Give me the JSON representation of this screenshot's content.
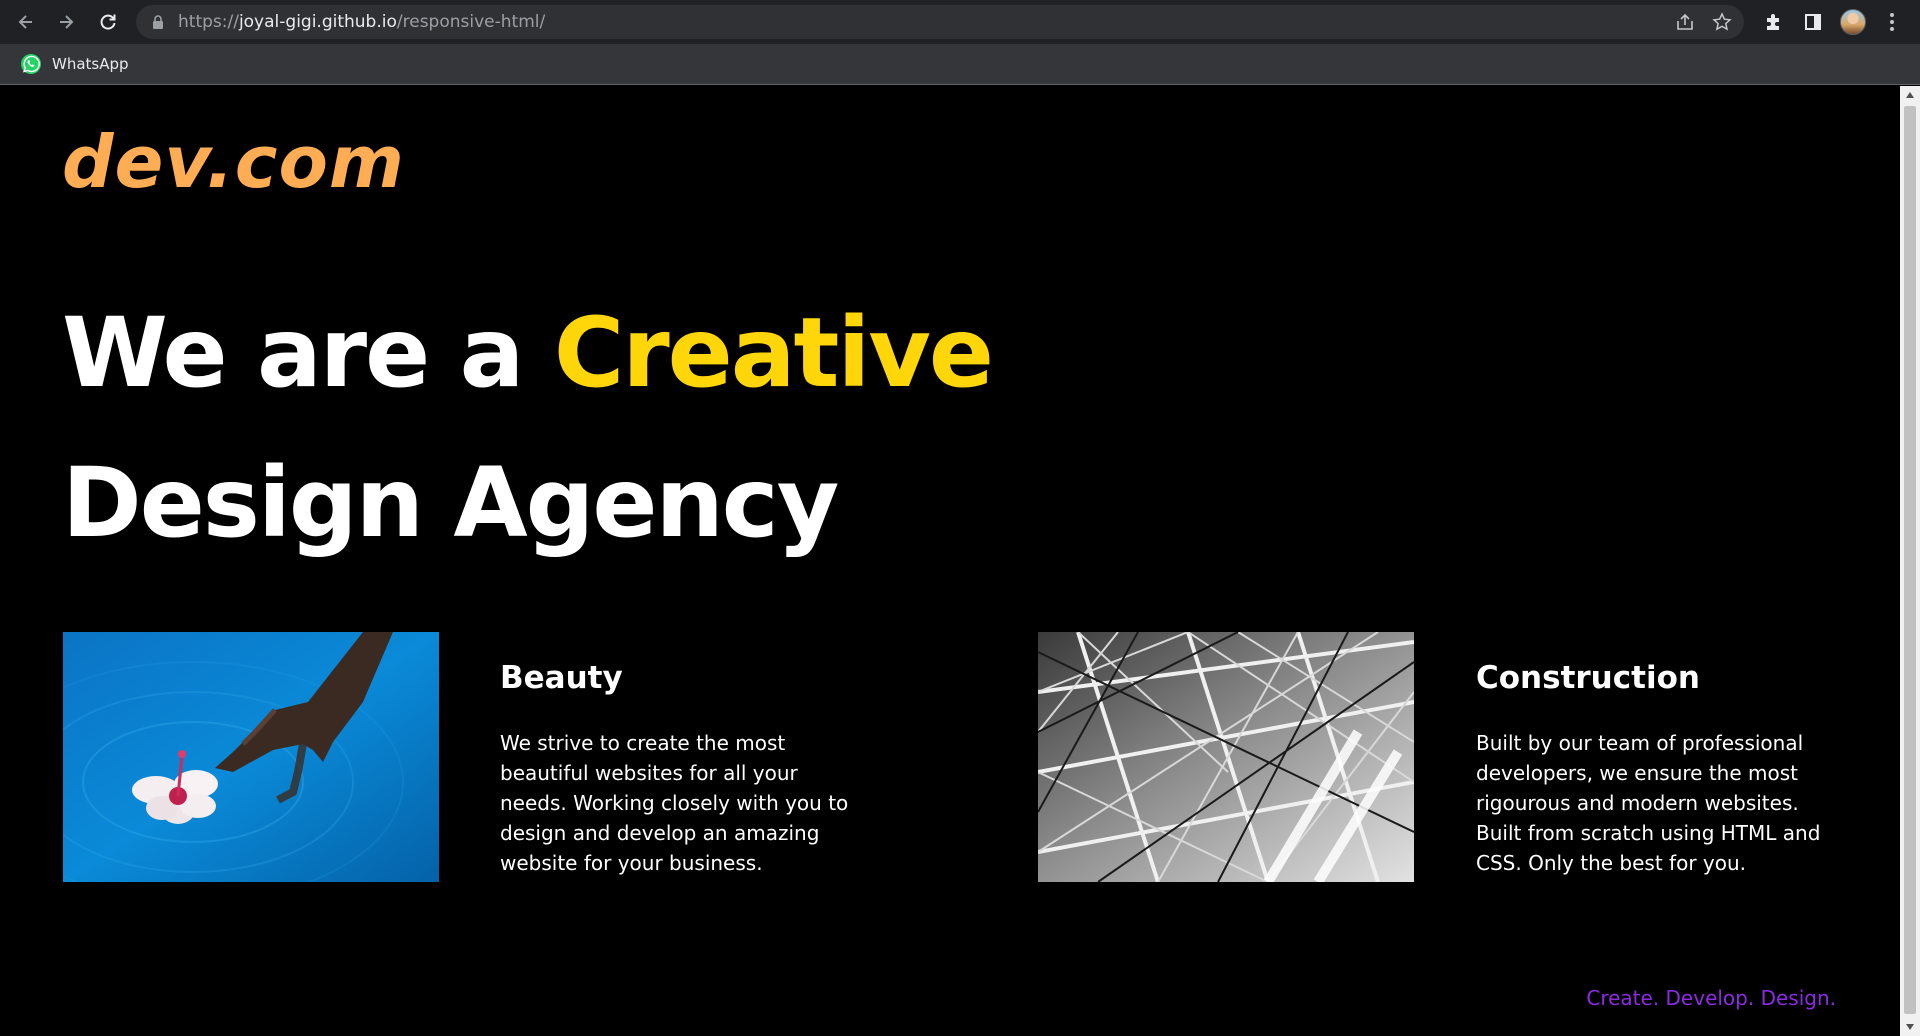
{
  "browser": {
    "url_scheme": "https://",
    "url_host": "joyal-gigi.github.io",
    "url_path": "/responsive-html/",
    "bookmarks": [
      {
        "label": "WhatsApp",
        "icon": "whatsapp-icon"
      }
    ]
  },
  "page": {
    "logo": "dev.com",
    "hero": {
      "line1_prefix": "We are a ",
      "line1_accent": "Creative",
      "line2": "Design Agency"
    },
    "cards": [
      {
        "title": "Beauty",
        "text": "We strive to create the most beautiful websites for all your needs. Working closely with you to design and develop an amazing website for your business.",
        "image": "hand-flower-water-photo"
      },
      {
        "title": "Construction",
        "text": "Built by our team of professional developers, we ensure the most rigourous and modern websites. Built from scratch using HTML and CSS. Only the best for you.",
        "image": "steel-structure-photo"
      }
    ],
    "tagline": "Create. Develop. Design."
  },
  "colors": {
    "logo": "#ffad55",
    "accent": "#ffd60a",
    "tagline": "#8a2be2",
    "background": "#000000"
  }
}
